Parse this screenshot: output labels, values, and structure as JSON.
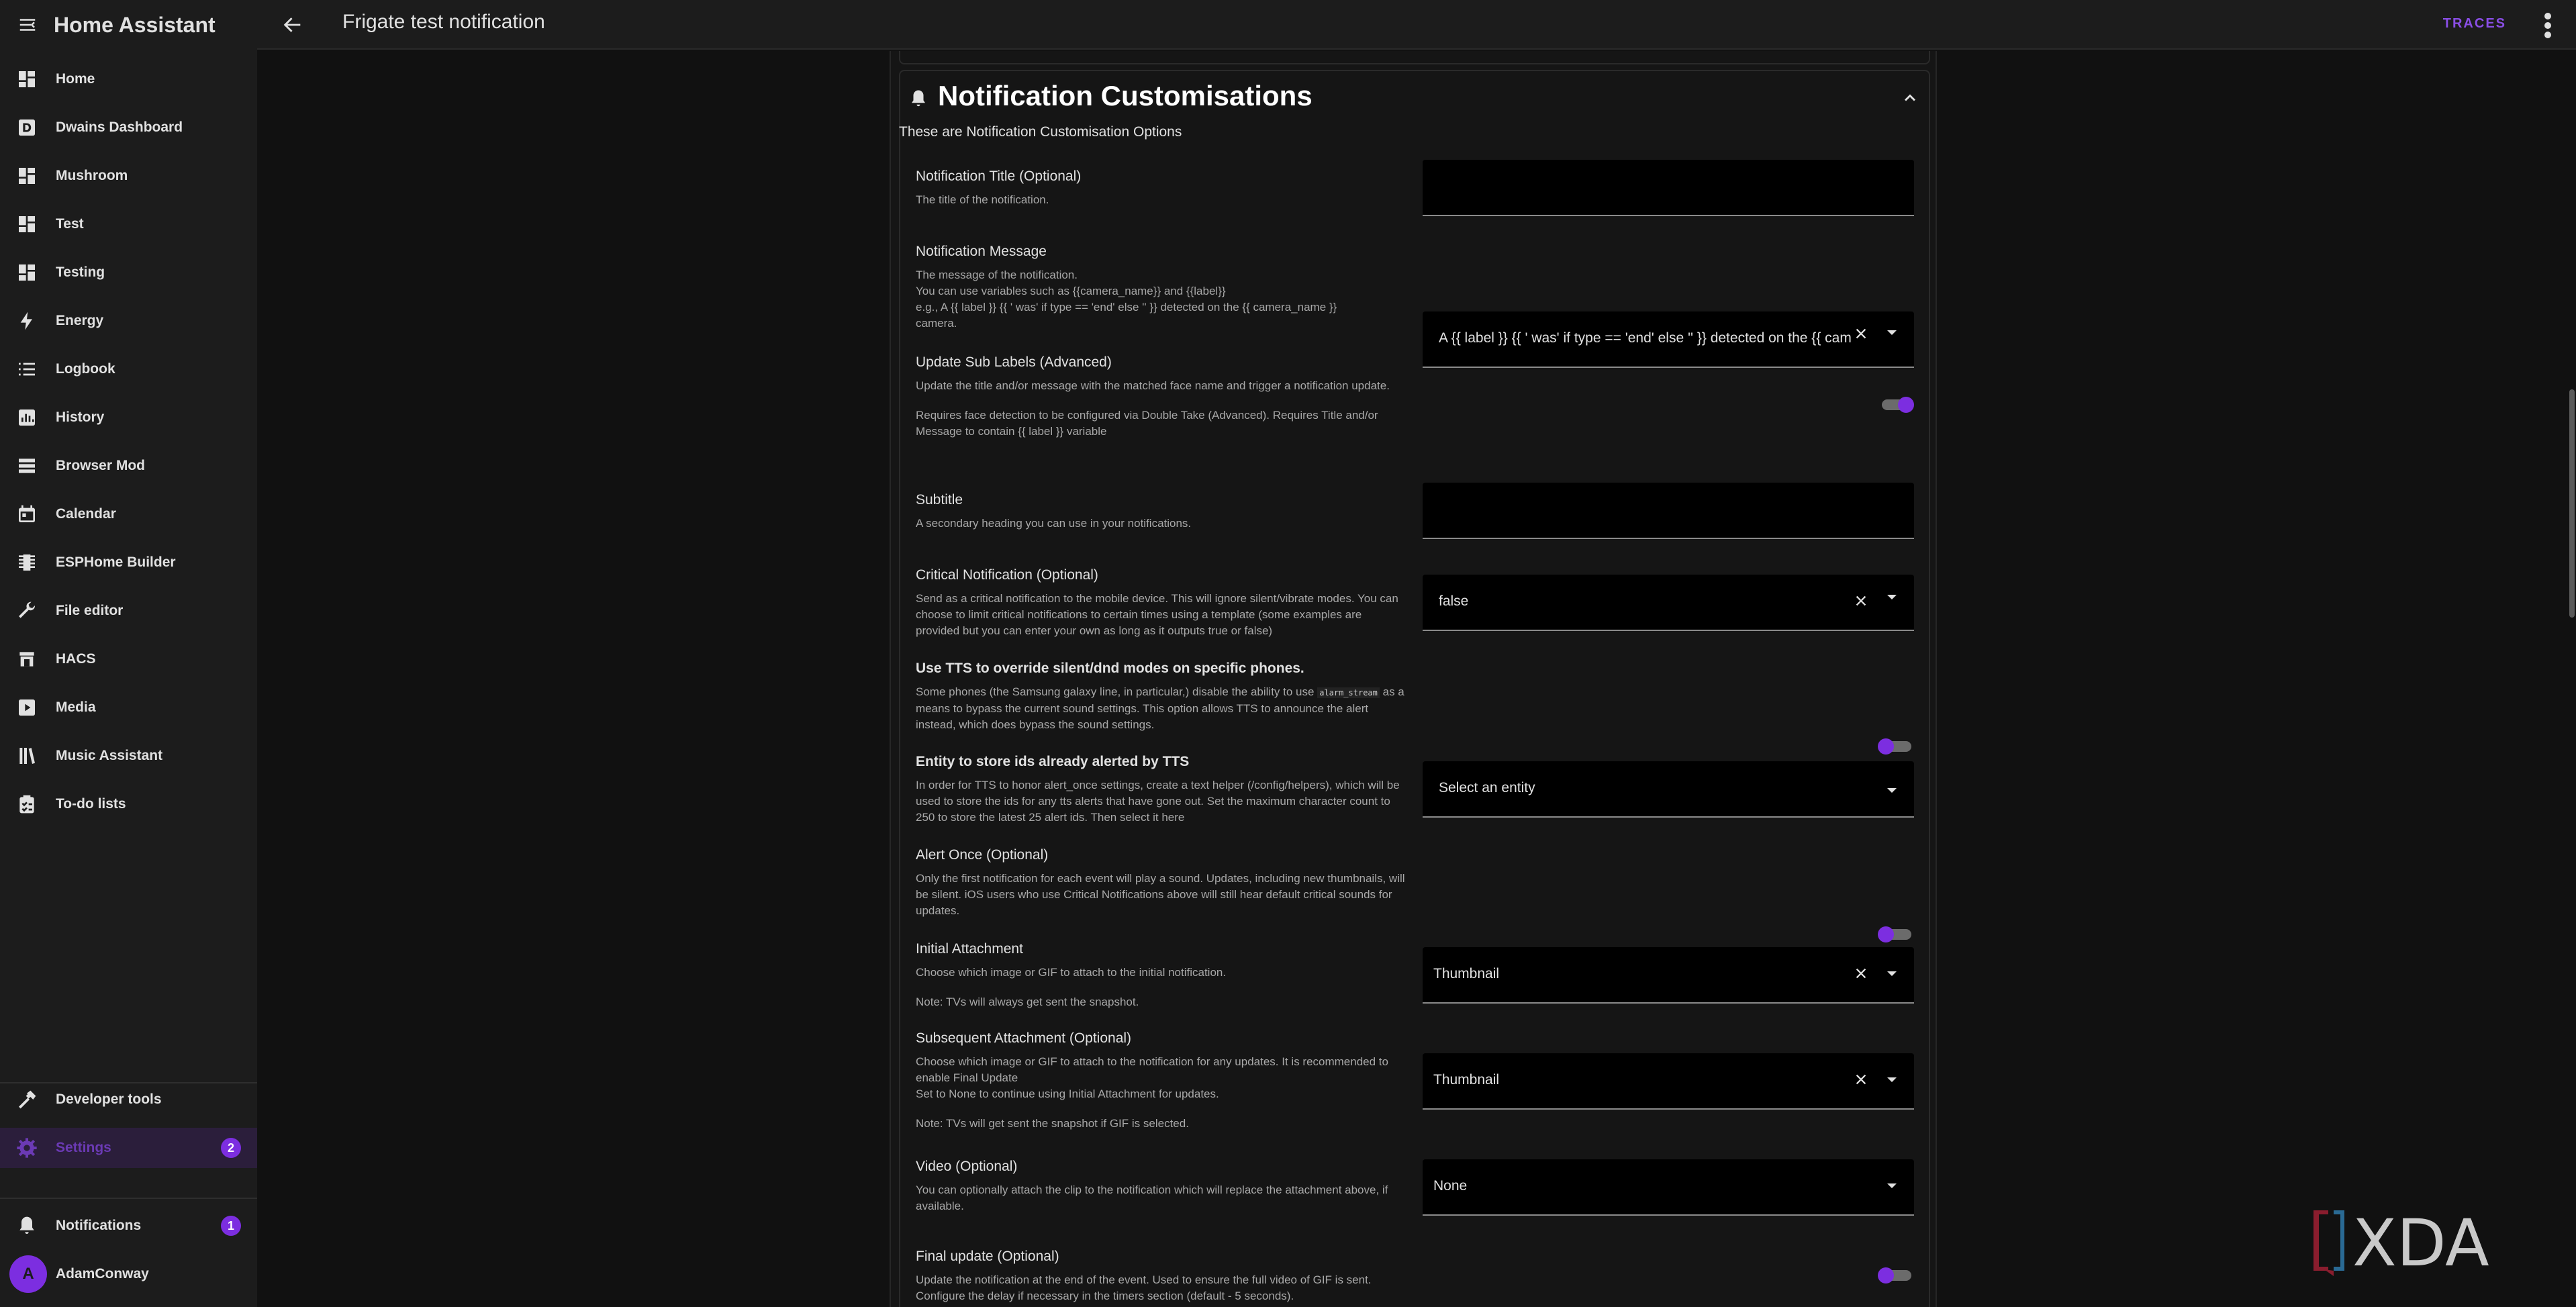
{
  "app": {
    "title": "Home Assistant"
  },
  "sidebar": {
    "items": [
      {
        "label": "Home",
        "icon": "dashboard-icon"
      },
      {
        "label": "Dwains Dashboard",
        "icon": "d-box-icon"
      },
      {
        "label": "Mushroom",
        "icon": "dashboard-icon"
      },
      {
        "label": "Test",
        "icon": "dashboard-icon"
      },
      {
        "label": "Testing",
        "icon": "dashboard-icon"
      },
      {
        "label": "Energy",
        "icon": "lightning-icon"
      },
      {
        "label": "Logbook",
        "icon": "list-icon"
      },
      {
        "label": "History",
        "icon": "chart-icon"
      },
      {
        "label": "Browser Mod",
        "icon": "server-icon"
      },
      {
        "label": "Calendar",
        "icon": "calendar-icon"
      },
      {
        "label": "ESPHome Builder",
        "icon": "chip-icon"
      },
      {
        "label": "File editor",
        "icon": "wrench-icon"
      },
      {
        "label": "HACS",
        "icon": "hacs-icon"
      },
      {
        "label": "Media",
        "icon": "play-box-icon"
      },
      {
        "label": "Music Assistant",
        "icon": "library-icon"
      },
      {
        "label": "To-do lists",
        "icon": "clipboard-icon"
      }
    ],
    "developer_tools": "Developer tools",
    "settings": "Settings",
    "settings_badge": "2",
    "notifications": "Notifications",
    "notifications_badge": "1",
    "user": "AdamConway",
    "user_initial": "A"
  },
  "topbar": {
    "title": "Frigate test notification",
    "traces": "TRACES"
  },
  "section": {
    "title": "Notification Customisations",
    "description": "These are Notification Customisation Options"
  },
  "rows": {
    "notif_title": {
      "title": "Notification Title (Optional)",
      "desc": "The title of the notification.",
      "value": ""
    },
    "notif_message": {
      "title": "Notification Message",
      "desc1": "The message of the notification.",
      "desc2": "You can use variables such as {{camera_name}} and {{label}}",
      "desc3": "e.g., A {{ label }} {{ ' was' if type == 'end' else '' }} detected on the {{ camera_name }}",
      "desc4": "camera.",
      "value": "A {{ label }} {{ ' was' if type == 'end' else '' }} detected on the {{ cam"
    },
    "sub_labels": {
      "title": "Update Sub Labels (Advanced)",
      "desc1": "Update the title and/or message with the matched face name and trigger a notification update.",
      "desc2": "Requires face detection to be configured via Double Take (Advanced). Requires Title and/or Message to contain {{ label }} variable"
    },
    "subtitle": {
      "title": "Subtitle",
      "desc": "A secondary heading you can use in your notifications.",
      "value": ""
    },
    "critical": {
      "title": "Critical Notification (Optional)",
      "desc": "Send as a critical notification to the mobile device. This will ignore silent/vibrate modes. You can choose to limit critical notifications to certain times using a template (some examples are provided but you can enter your own as long as it outputs true or false)",
      "value": "false"
    },
    "tts": {
      "title": "Use TTS to override silent/dnd modes on specific phones.",
      "desc_a": "Some phones (the Samsung galaxy line, in particular,) disable the ability to use",
      "code": "alarm_stream",
      "desc_b": "as a means to bypass the current sound settings. This option allows TTS to announce the alert instead, which does bypass the sound settings."
    },
    "entity_ids": {
      "title": "Entity to store ids already alerted by TTS",
      "desc": "In order for TTS to honor alert_once settings, create a text helper (/config/helpers), which will be used to store the ids for any tts alerts that have gone out. Set the maximum character count to 250 to store the latest 25 alert ids. Then select it here",
      "value": "Select an entity"
    },
    "alert_once": {
      "title": "Alert Once (Optional)",
      "desc": "Only the first notification for each event will play a sound. Updates, including new thumbnails, will be silent. iOS users who use Critical Notifications above will still hear default critical sounds for updates."
    },
    "initial_attach": {
      "title": "Initial Attachment",
      "desc1": "Choose which image or GIF to attach to the initial notification.",
      "desc2": "Note: TVs will always get sent the snapshot.",
      "value": "Thumbnail"
    },
    "subsequent_attach": {
      "title": "Subsequent Attachment (Optional)",
      "desc1": "Choose which image or GIF to attach to the notification for any updates. It is recommended to enable Final Update",
      "desc2": "Set to None to continue using Initial Attachment for updates.",
      "desc3": "Note: TVs will get sent the snapshot if GIF is selected.",
      "value": "Thumbnail"
    },
    "video": {
      "title": "Video (Optional)",
      "desc": "You can optionally attach the clip to the notification which will replace the attachment above, if available.",
      "value": "None"
    },
    "final_update": {
      "title": "Final update (Optional)",
      "desc": "Update the notification at the end of the event. Used to ensure the full video of GIF is sent. Configure the delay if necessary in the timers section (default - 5 seconds)."
    }
  },
  "watermark": "XDA",
  "colors": {
    "accent": "#7c2ee0",
    "background": "#111111",
    "sidebar": "#1c1c1c"
  }
}
